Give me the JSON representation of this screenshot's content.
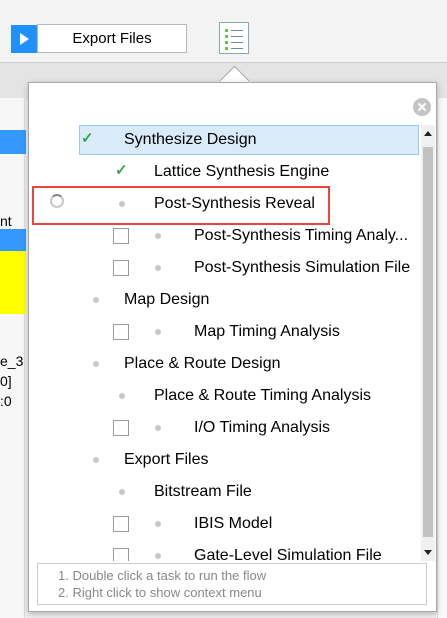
{
  "toolbar": {
    "export_label": "Export Files",
    "play_icon": "play-icon",
    "checklist_icon": "task-list-icon"
  },
  "background_fragments": [
    "nt",
    "e_3",
    "0]",
    ":0"
  ],
  "popup": {
    "close_icon": "close-icon",
    "tree": [
      {
        "label": "Synthesize Design",
        "marker": "check",
        "selected": true
      },
      {
        "label": "Lattice Synthesis Engine",
        "marker": "check"
      },
      {
        "label": "Post-Synthesis Reveal",
        "marker": "dot",
        "status": "running",
        "highlighted": true
      },
      {
        "label": "Post-Synthesis Timing Analy...",
        "marker": "dot",
        "checkbox": true
      },
      {
        "label": "Post-Synthesis Simulation File",
        "marker": "dot",
        "checkbox": true
      },
      {
        "label": "Map Design",
        "marker": "dot"
      },
      {
        "label": "Map Timing Analysis",
        "marker": "dot",
        "checkbox": true
      },
      {
        "label": "Place & Route Design",
        "marker": "dot"
      },
      {
        "label": "Place & Route Timing Analysis",
        "marker": "dot"
      },
      {
        "label": "I/O Timing Analysis",
        "marker": "dot",
        "checkbox": true
      },
      {
        "label": "Export Files",
        "marker": "dot"
      },
      {
        "label": "Bitstream File",
        "marker": "dot"
      },
      {
        "label": "IBIS Model",
        "marker": "dot",
        "checkbox": true
      },
      {
        "label": "Gate-Level Simulation File",
        "marker": "dot",
        "checkbox": true
      }
    ],
    "hints": [
      "1. Double click a task to run the flow",
      "2. Right click to show context menu"
    ]
  },
  "colors": {
    "accent": "#1e90ff",
    "check": "#2fa84f",
    "highlight_border": "#e8453c",
    "selection_bg": "#d9ebf9"
  }
}
